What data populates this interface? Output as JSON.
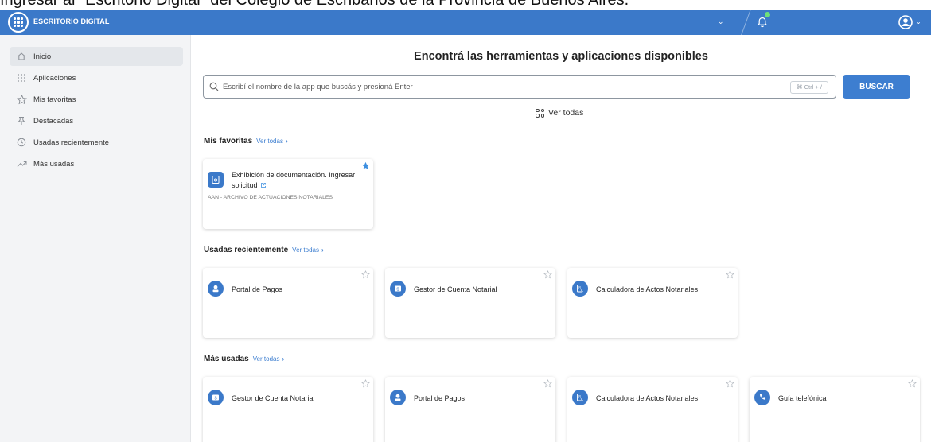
{
  "caption": {
    "text": "Ingresar al \"Escritorio Digital\" del Colegio de Escribanos de la Provincia de Buenos Aires."
  },
  "header": {
    "brand": "ESCRITORIO DIGITAL",
    "accent_color": "#3b79c9",
    "icons": [
      "apps-grid-icon",
      "chevron-down-icon",
      "bell-icon",
      "user-circle-icon"
    ]
  },
  "sidebar": {
    "items": [
      {
        "label": "Inicio",
        "icon": "home-icon",
        "active": true
      },
      {
        "label": "Aplicaciones",
        "icon": "grid-icon",
        "active": false
      },
      {
        "label": "Mis favoritas",
        "icon": "star-icon",
        "active": false
      },
      {
        "label": "Destacadas",
        "icon": "pin-icon",
        "active": false
      },
      {
        "label": "Usadas recientemente",
        "icon": "clock-icon",
        "active": false
      },
      {
        "label": "Más usadas",
        "icon": "trending-icon",
        "active": false
      }
    ]
  },
  "main": {
    "title": "Encontrá las herramientas y aplicaciones disponibles",
    "search": {
      "placeholder": "Escribí el nombre de la app que buscás y presioná Enter",
      "shortcut": "⌘ Ctrl + /",
      "button": "BUSCAR"
    },
    "ver_todas": "Ver todas",
    "sections": {
      "favoritas": {
        "title": "Mis favoritas",
        "link": "Ver todas",
        "cards": [
          {
            "title": "Exhibición de documentación. Ingresar solicitud",
            "subtitle": "AAN - ARCHIVO DE ACTUACIONES NOTARIALES",
            "starred": true
          }
        ]
      },
      "recientes": {
        "title": "Usadas recientemente",
        "link": "Ver todas",
        "cards": [
          {
            "title": "Portal de Pagos",
            "icon": "payments-icon"
          },
          {
            "title": "Gestor de Cuenta Notarial",
            "icon": "account-icon"
          },
          {
            "title": "Calculadora de Actos Notariales",
            "icon": "calculator-icon"
          }
        ]
      },
      "mas_usadas": {
        "title": "Más usadas",
        "link": "Ver todas",
        "cards": [
          {
            "title": "Gestor de Cuenta Notarial",
            "icon": "account-icon"
          },
          {
            "title": "Portal de Pagos",
            "icon": "payments-icon"
          },
          {
            "title": "Calculadora de Actos Notariales",
            "icon": "calculator-icon"
          },
          {
            "title": "Guía telefónica",
            "icon": "phone-icon"
          }
        ]
      }
    }
  }
}
